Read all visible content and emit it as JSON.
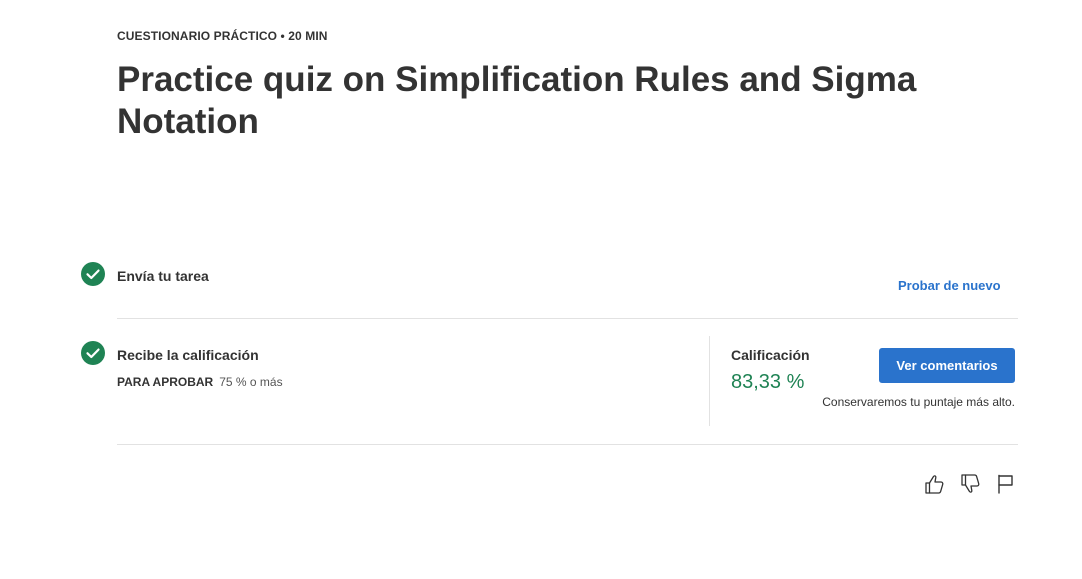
{
  "header": {
    "eyebrow": "CUESTIONARIO PRÁCTICO • 20 MIN",
    "title": "Practice quiz on Simplification Rules and Sigma Notation"
  },
  "steps": {
    "submit": {
      "label": "Envía tu tarea",
      "retry_link": "Probar de nuevo",
      "icon": "check-circle-icon"
    },
    "grade": {
      "label": "Recibe la calificación",
      "pass_label": "PARA APROBAR",
      "pass_value": "75 % o más",
      "icon": "check-circle-icon"
    }
  },
  "grade": {
    "label": "Calificación",
    "value": "83,33 %",
    "button": "Ver comentarios",
    "note": "Conservaremos tu puntaje más alto."
  },
  "feedback": {
    "like": "thumbs-up-icon",
    "dislike": "thumbs-down-icon",
    "report": "flag-icon"
  },
  "colors": {
    "success": "#1f8354",
    "accent": "#2a73cc",
    "text": "#333333"
  }
}
